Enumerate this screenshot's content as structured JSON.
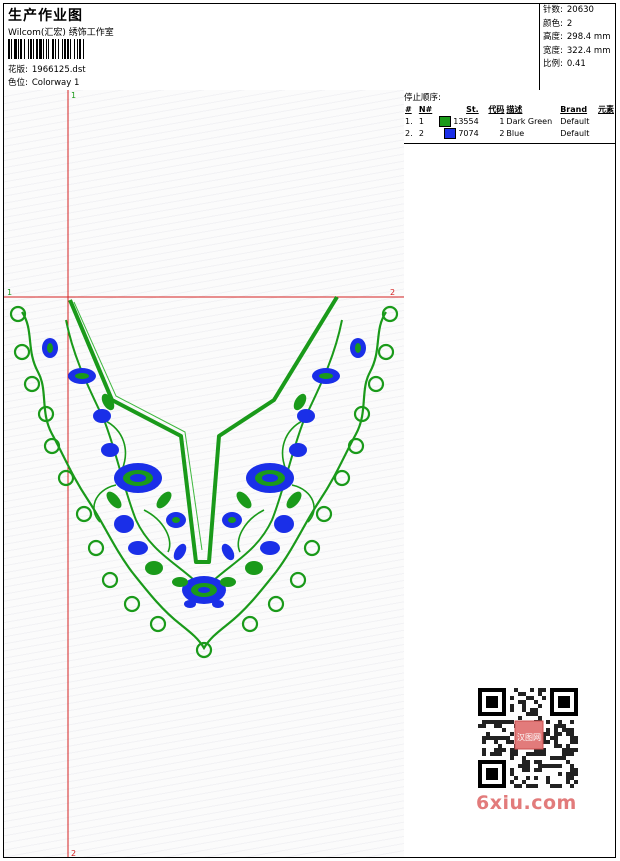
{
  "header": {
    "title": "生产作业图",
    "subtitle": "Wilcom(汇宏) 绣饰工作室",
    "design_label": "花版:",
    "design_value": "1966125.dst",
    "colorway_label": "色位:",
    "colorway_value": "Colorway 1"
  },
  "stats": [
    {
      "label": "针数:",
      "value": "20630"
    },
    {
      "label": "颜色:",
      "value": "2"
    },
    {
      "label": "高度:",
      "value": "298.4 mm"
    },
    {
      "label": "宽度:",
      "value": "322.4 mm"
    },
    {
      "label": "比例:",
      "value": "0.41"
    }
  ],
  "stop_sequence": {
    "caption": "停止顺序:",
    "columns": [
      "#",
      "N#",
      "St.",
      "代码",
      "描述",
      "Brand",
      "元素"
    ],
    "rows": [
      {
        "idx": "1.",
        "n": "1",
        "color": "#1a9a1a",
        "stitches": "13554",
        "code": "1",
        "desc": "Dark Green",
        "brand": "Default"
      },
      {
        "idx": "2.",
        "n": "2",
        "color": "#1a2fe8",
        "stitches": "7074",
        "code": "2",
        "desc": "Blue",
        "brand": "Default"
      }
    ]
  },
  "guides": {
    "v_top": "1",
    "v_bottom": "2",
    "h_left": "1",
    "h_right": "2"
  },
  "colors": {
    "green": "#1a9a1a",
    "blue": "#1a2fe8",
    "guide": "#d42020",
    "watermark": "#e27b7b"
  },
  "watermark": {
    "text": "6xiu.com",
    "seal": "汉图网"
  }
}
